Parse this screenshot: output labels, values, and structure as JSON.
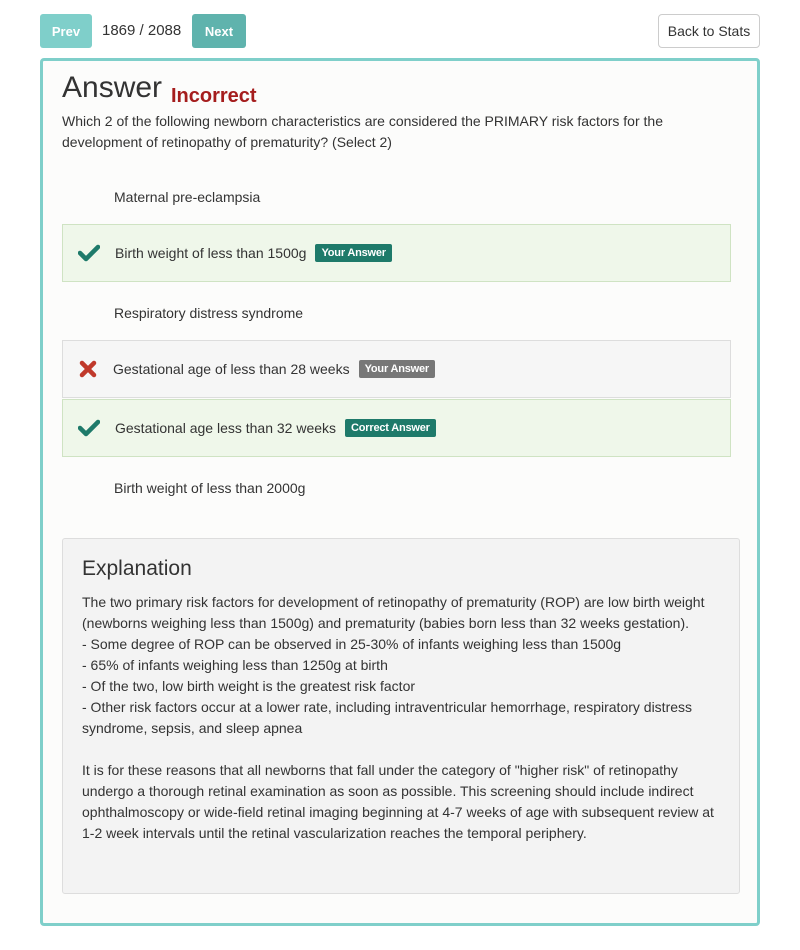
{
  "nav": {
    "prev_label": "Prev",
    "counter": "1869 / 2088",
    "next_label": "Next",
    "back_label": "Back to Stats"
  },
  "answer": {
    "heading": "Answer",
    "status": "Incorrect",
    "status_color": "#a51d1d",
    "question": "Which 2 of the following newborn characteristics are considered the PRIMARY risk factors for the development of retinopathy of prematurity? (Select 2)"
  },
  "choices": [
    {
      "label": "Maternal pre-eclampsia",
      "mark": "",
      "badge": ""
    },
    {
      "label": "Birth weight of less than 1500g",
      "mark": "check-icon",
      "badge": "Your Answer"
    },
    {
      "label": "Respiratory distress syndrome",
      "mark": "",
      "badge": ""
    },
    {
      "label": "Gestational age of less than 28 weeks",
      "mark": "x-icon",
      "badge": "Your Answer"
    },
    {
      "label": "Gestational age less than 32 weeks",
      "mark": "check-icon",
      "badge": "Correct Answer"
    },
    {
      "label": "Birth weight of less than 2000g",
      "mark": "",
      "badge": ""
    }
  ],
  "explanation": {
    "title": "Explanation",
    "lines": [
      "The two primary risk factors for development of retinopathy of prematurity (ROP) are low birth weight (newborns weighing less than 1500g) and prematurity (babies born less than 32 weeks gestation).",
      "- Some degree of ROP can be observed in 25-30% of infants weighing less than 1500g",
      "- 65% of infants weighing less than 1250g at birth",
      "- Of the two, low birth weight is the greatest risk factor",
      "- Other risk factors occur at a lower rate, including intraventricular hemorrhage, respiratory distress syndrome, sepsis, and sleep apnea",
      "It is for these reasons that all newborns that fall under the category of \"higher risk\" of retinopathy undergo a thorough retinal examination as soon as possible. This screening should include indirect ophthalmoscopy or wide-field retinal imaging beginning at 4-7 weeks of age with subsequent review at 1-2 week intervals until the retinal vascularization reaches the temporal periphery."
    ]
  },
  "colors": {
    "accent": "#7fcfca",
    "correct": "#1e7a6a",
    "wrong": "#c0392b"
  }
}
